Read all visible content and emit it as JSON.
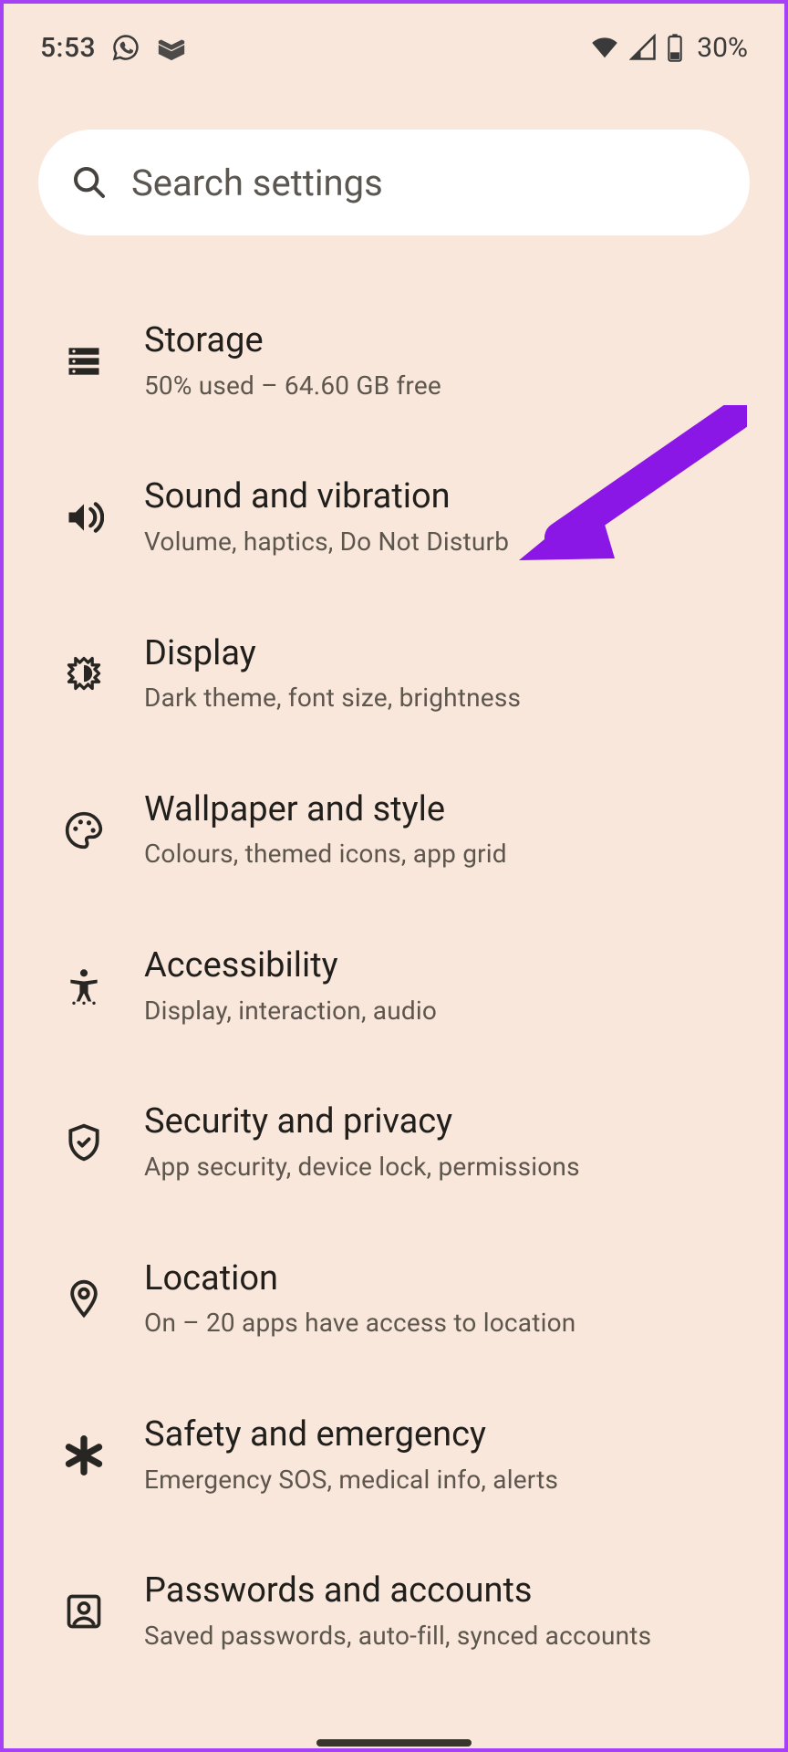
{
  "status": {
    "time": "5:53",
    "battery_text": "30%"
  },
  "search": {
    "placeholder": "Search settings"
  },
  "items": [
    {
      "icon": "storage",
      "title": "Storage",
      "sub": "50% used – 64.60 GB free"
    },
    {
      "icon": "sound",
      "title": "Sound and vibration",
      "sub": "Volume, haptics, Do Not Disturb"
    },
    {
      "icon": "display",
      "title": "Display",
      "sub": "Dark theme, font size, brightness"
    },
    {
      "icon": "palette",
      "title": "Wallpaper and style",
      "sub": "Colours, themed icons, app grid"
    },
    {
      "icon": "accessibility",
      "title": "Accessibility",
      "sub": "Display, interaction, audio"
    },
    {
      "icon": "shield",
      "title": "Security and privacy",
      "sub": "App security, device lock, permissions"
    },
    {
      "icon": "location",
      "title": "Location",
      "sub": "On – 20 apps have access to location"
    },
    {
      "icon": "asterisk",
      "title": "Safety and emergency",
      "sub": "Emergency SOS, medical info, alerts"
    },
    {
      "icon": "account",
      "title": "Passwords and accounts",
      "sub": "Saved passwords, auto-fill, synced accounts"
    }
  ],
  "annotation": {
    "color": "#8a17e6"
  }
}
